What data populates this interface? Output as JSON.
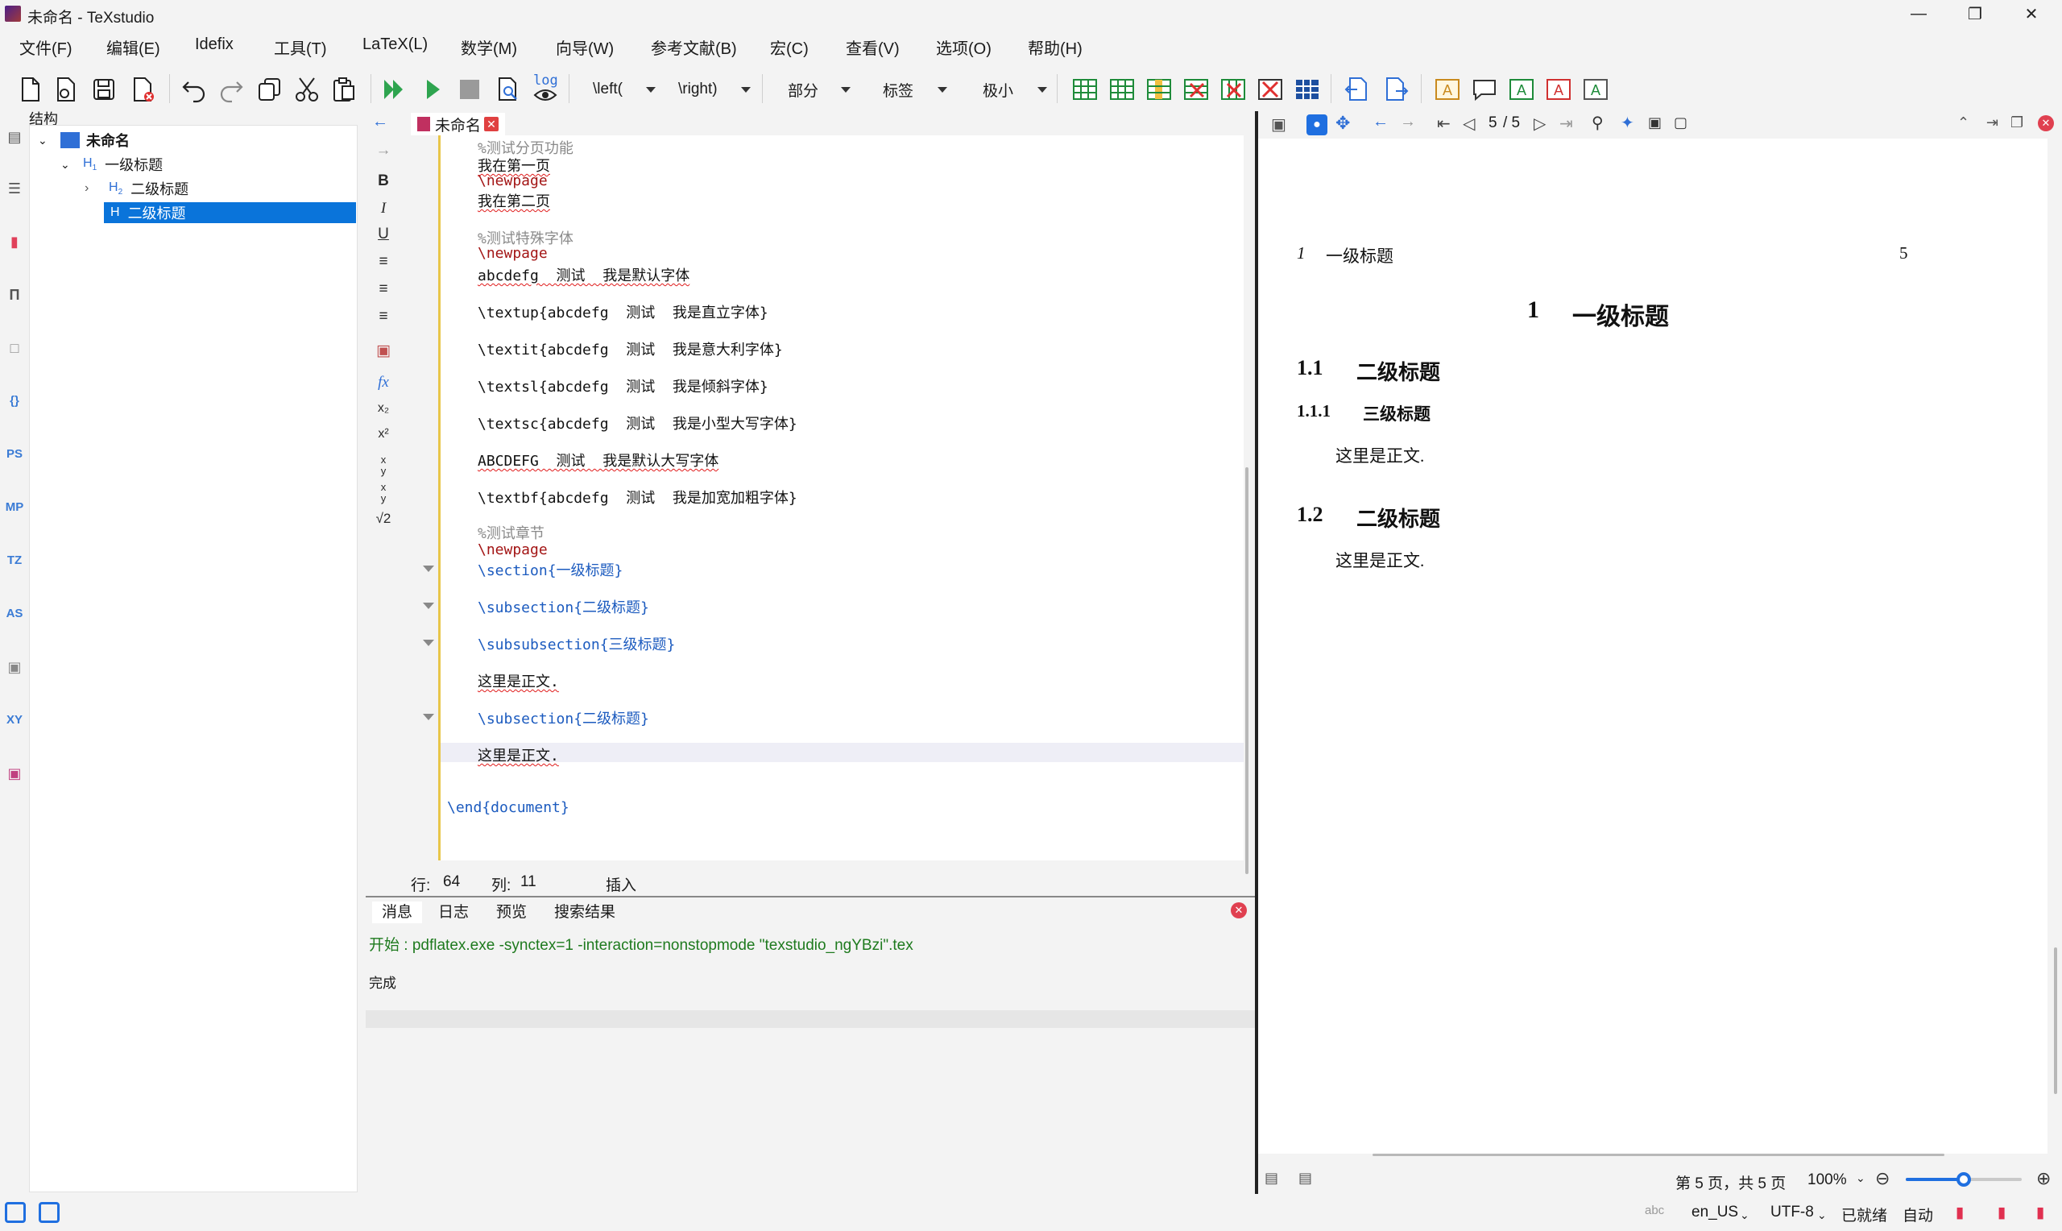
{
  "window": {
    "title": "未命名 - TeXstudio"
  },
  "menu": [
    "文件(F)",
    "编辑(E)",
    "Idefix",
    "工具(T)",
    "LaTeX(L)",
    "数学(M)",
    "向导(W)",
    "参考文献(B)",
    "宏(C)",
    "查看(V)",
    "选项(O)",
    "帮助(H)"
  ],
  "toolbar": {
    "left_cmd": "\\left(",
    "right_cmd": "\\right)",
    "section_combo": "部分",
    "label_combo": "标签",
    "size_combo": "极小",
    "log_label": "log"
  },
  "structure": {
    "title": "结构",
    "items": [
      {
        "label": "未命名",
        "level": "root"
      },
      {
        "label": "一级标题",
        "level": "H1"
      },
      {
        "label": "二级标题",
        "level": "H2"
      },
      {
        "label": "二级标题",
        "level": "H2",
        "selected": true
      }
    ]
  },
  "editor": {
    "tab_label": "未命名",
    "lines": [
      "%测试分页功能",
      "我在第一页",
      "\\newpage",
      "我在第二页",
      "%测试特殊字体",
      "\\newpage",
      "abcdefg  测试  我是默认字体",
      "\\textup{abcdefg  测试  我是直立字体}",
      "\\textit{abcdefg  测试  我是意大利字体}",
      "\\textsl{abcdefg  测试  我是倾斜字体}",
      "\\textsc{abcdefg  测试  我是小型大写字体}",
      "ABCDEFG  测试  我是默认大写字体",
      "\\textbf{abcdefg  测试  我是加宽加粗字体}",
      "%测试章节",
      "\\newpage",
      "\\section{一级标题}",
      "\\subsection{二级标题}",
      "\\subsubsection{三级标题}",
      "这里是正文.",
      "\\subsection{二级标题}",
      "这里是正文.",
      "\\end{document}"
    ],
    "status": {
      "line_label": "行:",
      "line": "64",
      "col_label": "列:",
      "col": "11",
      "mode": "插入"
    }
  },
  "messages": {
    "tabs": [
      "消息",
      "日志",
      "预览",
      "搜索结果"
    ],
    "start_line": "开始 : pdflatex.exe -synctex=1 -interaction=nonstopmode \"texstudio_ngYBzi\".tex",
    "done": "完成"
  },
  "pdf": {
    "page_current": "5",
    "page_total": "/ 5",
    "header_num": "1",
    "header_title": "一级标题",
    "header_page": "5",
    "section_num": "1",
    "section_title": "一级标题",
    "sub1_num": "1.1",
    "sub1_title": "二级标题",
    "subsub_num": "1.1.1",
    "subsub_title": "三级标题",
    "body1": "这里是正文.",
    "sub2_num": "1.2",
    "sub2_title": "二级标题",
    "body2": "这里是正文.",
    "page_info": "第 5 页，共 5 页",
    "zoom": "100%",
    "zoom_level": 0.5
  },
  "statusbar": {
    "spell": "abc",
    "language": "en_US",
    "encoding": "UTF-8",
    "ready": "已就绪",
    "auto": "自动"
  }
}
